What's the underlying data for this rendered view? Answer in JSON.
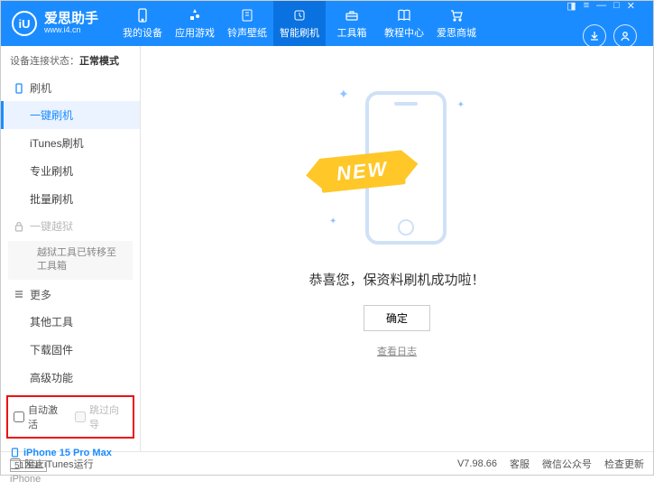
{
  "header": {
    "logo_letter": "iU",
    "app_name": "爱思助手",
    "url": "www.i4.cn"
  },
  "nav": {
    "items": [
      {
        "label": "我的设备"
      },
      {
        "label": "应用游戏"
      },
      {
        "label": "铃声壁纸"
      },
      {
        "label": "智能刷机"
      },
      {
        "label": "工具箱"
      },
      {
        "label": "教程中心"
      },
      {
        "label": "爱思商城"
      }
    ]
  },
  "sidebar": {
    "status_label": "设备连接状态：",
    "status_value": "正常模式",
    "section_flash": "刷机",
    "items_flash": [
      "一键刷机",
      "iTunes刷机",
      "专业刷机",
      "批量刷机"
    ],
    "section_jailbreak": "一键越狱",
    "jailbreak_note": "越狱工具已转移至工具箱",
    "section_more": "更多",
    "items_more": [
      "其他工具",
      "下载固件",
      "高级功能"
    ],
    "chk_auto_activate": "自动激活",
    "chk_skip_guide": "跳过向导",
    "device": {
      "name": "iPhone 15 Pro Max",
      "storage": "512GB",
      "type": "iPhone"
    }
  },
  "main": {
    "new_badge": "NEW",
    "success_text": "恭喜您，保资料刷机成功啦！",
    "ok_button": "确定",
    "log_link": "查看日志"
  },
  "footer": {
    "chk_block_itunes": "阻止iTunes运行",
    "version": "V7.98.66",
    "links": [
      "客服",
      "微信公众号",
      "检查更新"
    ]
  }
}
